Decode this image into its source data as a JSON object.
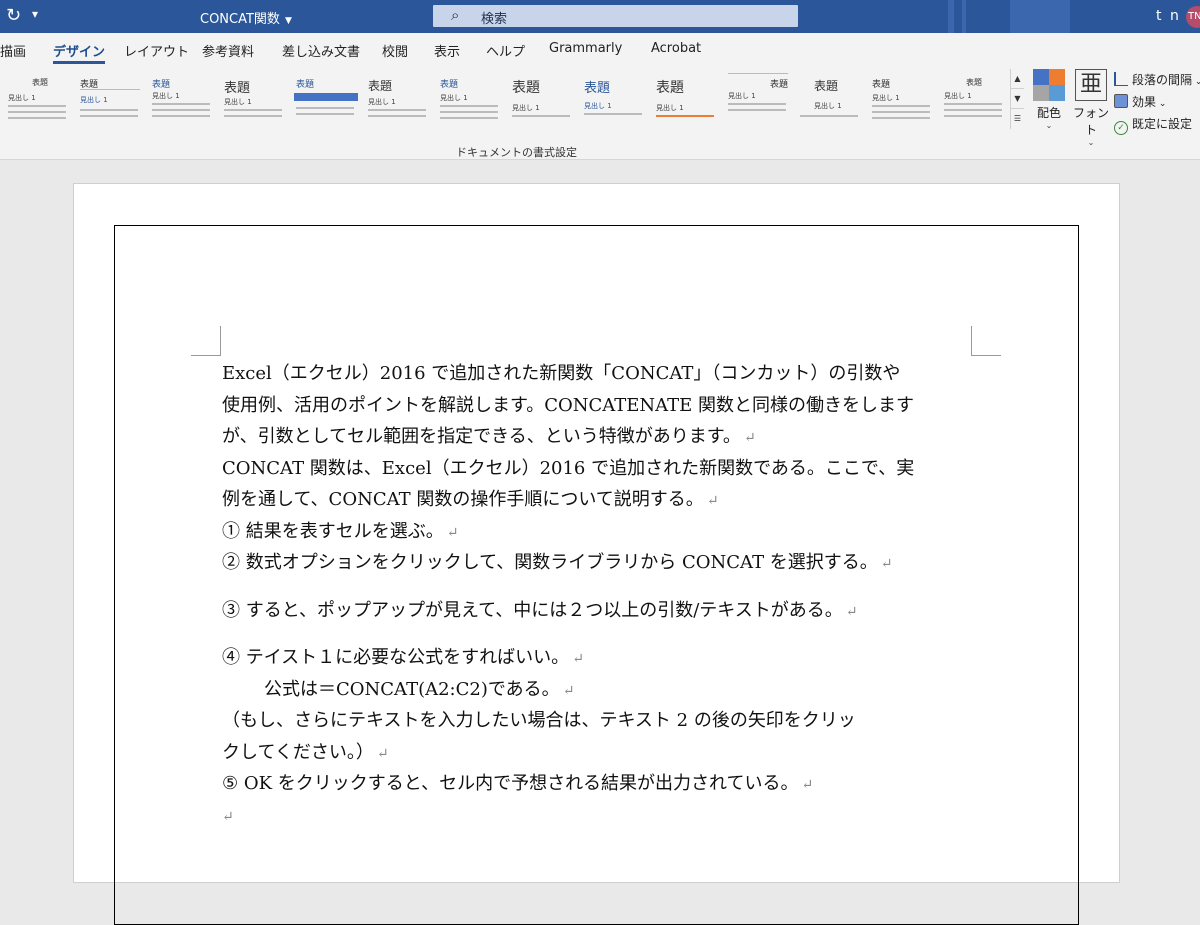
{
  "titlebar": {
    "refresh_icon": "refresh-icon",
    "quick_access_icon": "chevron-down-icon",
    "doc_title": "CONCAT関数",
    "search_placeholder": "検索",
    "user_initials": "t n",
    "avatar": "TN"
  },
  "tabs": [
    "描画",
    "デザイン",
    "レイアウト",
    "参考資料",
    "差し込み文書",
    "校閲",
    "表示",
    "ヘルプ",
    "Grammarly",
    "Acrobat"
  ],
  "active_tab": "デザイン",
  "ribbon": {
    "gallery_titles": [
      "表題",
      "表題",
      "表題",
      "表題",
      "表題",
      "表題",
      "表題",
      "表題",
      "表題",
      "表題",
      "表題",
      "表題",
      "表題",
      "表題"
    ],
    "gallery_heading": "見出し 1",
    "colors_label": "配色",
    "fonts_label": "フォント",
    "fonts_glyph": "亜",
    "paragraph_spacing": "段落の間隔",
    "effects": "効果",
    "set_default": "既定に設定",
    "group_label": "ドキュメントの書式設定",
    "colors": {
      "swatch1": "#4472c4",
      "swatch2": "#ed7d31",
      "swatch3": "#a5a5a5",
      "swatch4": "#5b9bd5"
    }
  },
  "document": {
    "lines": [
      "Excel（エクセル）2016 で追加された新関数「CONCAT」（コンカット）の引数や",
      "使用例、活用のポイントを解説します。CONCATENATE 関数と同様の働きをします",
      "が、引数としてセル範囲を指定できる、という特徴があります。",
      "CONCAT 関数は、Excel（エクセル）2016 で追加された新関数である。ここで、実",
      "例を通して、CONCAT 関数の操作手順について説明する。",
      "① 結果を表すセルを選ぶ。",
      "② 数式オプションをクリックして、関数ライブラリから CONCAT を選択する。",
      "③ すると、ポップアップが見えて、中には２つ以上の引数/テキストがある。",
      "④ テイスト１に必要な公式をすればいい。",
      "公式は＝CONCAT(A2:C2)である。",
      "（もし、さらにテキストを入力したい場合は、テキスト 2 の後の矢印をクリッ",
      "クしてください。）",
      "⑤ OK をクリックすると、セル内で予想される結果が出力されている。",
      ""
    ],
    "return_mark": "↵"
  }
}
